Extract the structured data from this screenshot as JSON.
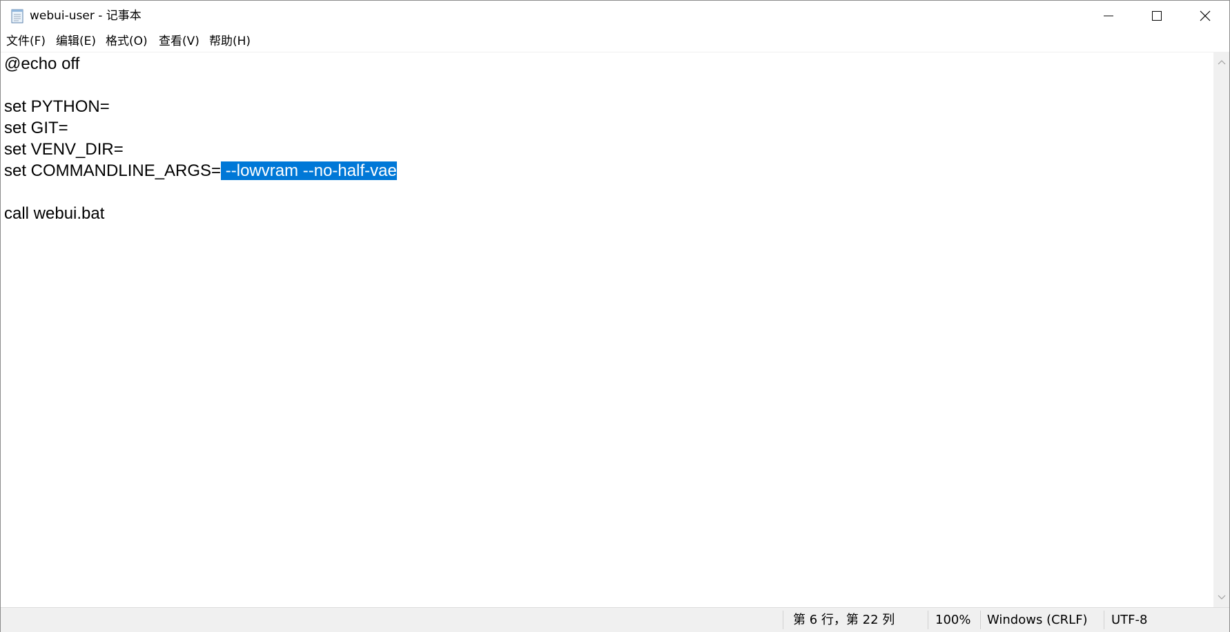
{
  "window": {
    "title": "webui-user - 记事本",
    "controls": {
      "minimize": "minimize-icon",
      "maximize": "maximize-icon",
      "close": "close-icon"
    }
  },
  "menu": {
    "file": "文件(F)",
    "edit": "编辑(E)",
    "format": "格式(O)",
    "view": "查看(V)",
    "help": "帮助(H)"
  },
  "editor": {
    "lines": [
      "@echo off",
      "",
      "set PYTHON=",
      "set GIT=",
      "set VENV_DIR=",
      "set COMMANDLINE_ARGS=",
      "",
      "call webui.bat"
    ],
    "selected_text": " --lowvram --no-half-vae",
    "selection_color": "#0078d7"
  },
  "status": {
    "position": "第 6 行，第 22 列",
    "zoom": "100%",
    "line_ending": "Windows (CRLF)",
    "encoding": "UTF-8"
  }
}
